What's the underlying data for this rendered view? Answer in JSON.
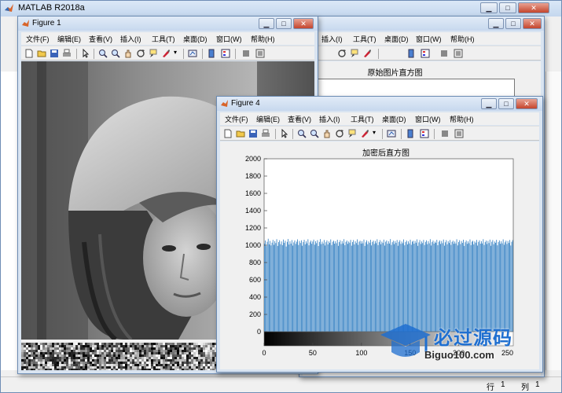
{
  "main_window": {
    "title": "MATLAB R2018a",
    "status_row_label": "行",
    "status_row_value": "1",
    "status_col_label": "列",
    "status_col_value": "1"
  },
  "figure1": {
    "title": "Figure 1",
    "menu": [
      "文件(F)",
      "编辑(E)",
      "查看(V)",
      "插入(I)",
      "工具(T)",
      "桌面(D)",
      "窗口(W)",
      "帮助(H)"
    ]
  },
  "figure_behind": {
    "menu": [
      "插入(I)",
      "工具(T)",
      "桌面(D)",
      "窗口(W)",
      "帮助(H)"
    ],
    "axes_title": "原始图片直方图"
  },
  "figure4": {
    "title": "Figure 4",
    "menu": [
      "文件(F)",
      "编辑(E)",
      "查看(V)",
      "插入(I)",
      "工具(T)",
      "桌面(D)",
      "窗口(W)",
      "帮助(H)"
    ]
  },
  "toolbar_icons": [
    "new-figure-icon",
    "open-file-icon",
    "save-icon",
    "print-icon",
    "edit-plot-icon",
    "zoom-in-icon",
    "zoom-out-icon",
    "pan-icon",
    "rotate-3d-icon",
    "data-cursor-icon",
    "brush-icon",
    "link-plot-icon",
    "colorbar-icon",
    "legend-icon",
    "hide-plot-tools-icon",
    "show-plot-tools-icon"
  ],
  "chart_data": {
    "type": "bar",
    "title": "加密后直方图",
    "xlim": [
      0,
      255
    ],
    "ylim": [
      0,
      2000
    ],
    "xticks": [
      0,
      50,
      100,
      150,
      200,
      250
    ],
    "yticks": [
      0,
      200,
      400,
      600,
      800,
      1000,
      1200,
      1400,
      1600,
      1800,
      2000
    ],
    "bar_color": "#2f7dc1",
    "bins": 256,
    "series": [
      {
        "x_range": [
          0,
          255
        ],
        "values": [
          1020,
          1055,
          990,
          1040,
          1075,
          1010,
          1050,
          998,
          1030,
          1062,
          1005,
          1048,
          1025,
          1070,
          992,
          1036,
          1058,
          1012,
          1044,
          1001,
          1066,
          1028,
          1052,
          985,
          1039,
          1072,
          1008,
          1046,
          1019,
          1060,
          996,
          1033,
          1055,
          1015,
          1041,
          1068,
          1003,
          1049,
          1026,
          1057,
          994,
          1037,
          1063,
          1011,
          1045,
          1022,
          1069,
          999,
          1034,
          1054,
          1017,
          1043,
          1065,
          1006,
          1047,
          1024,
          1059,
          991,
          1038,
          1071,
          1013,
          1042,
          1020,
          1061,
          997,
          1035,
          1056,
          1009,
          1044,
          1027,
          1067,
          1002,
          1040,
          1053,
          1018,
          1046,
          1023,
          1064,
          993,
          1036,
          1058,
          1014,
          1048,
          1021,
          1070,
          1000,
          1039,
          1055,
          1016,
          1043,
          1029,
          1062,
          995,
          1037,
          1060,
          1010,
          1045,
          1025,
          1068,
          1004,
          1041,
          1052,
          1019,
          1047,
          1022,
          1066,
          992,
          1034,
          1057,
          1012,
          1044,
          1028,
          1063,
          998,
          1038,
          1054,
          1015,
          1049,
          1024,
          1069,
          1001,
          1036,
          1059,
          1011,
          1042,
          1026,
          1065,
          996,
          1040,
          1056,
          1017,
          1046,
          1020,
          1071,
          1003,
          1035,
          1053,
          1013,
          1048,
          1027,
          1061,
          994,
          1039,
          1058,
          1016,
          1043,
          1023,
          1067,
          999,
          1037,
          1055,
          1010,
          1045,
          1021,
          1064,
          1005,
          1041,
          1052,
          1018,
          1050,
          1029,
          1068,
          993,
          1033,
          1060,
          1014,
          1044,
          1025,
          1062,
          1002,
          1038,
          1057,
          1012,
          1047,
          1022,
          1070,
          997,
          1036,
          1054,
          1019,
          1042,
          1028,
          1063,
          1000,
          1040,
          1056,
          1015,
          1049,
          1024,
          1066,
          995,
          1034,
          1059,
          1011,
          1046,
          1026,
          1061,
          1004,
          1039,
          1053,
          1017,
          1043,
          1020,
          1069,
          998,
          1037,
          1058,
          1013,
          1048,
          1027,
          1064,
          992,
          1035,
          1055,
          1016,
          1045,
          1023,
          1067,
          1001,
          1041,
          1052,
          1010,
          1044,
          1029,
          1062,
          996,
          1038,
          1057,
          1018,
          1047,
          1021,
          1070,
          1003,
          1036,
          1054,
          1014,
          1050,
          1025,
          1065,
          994,
          1040,
          1060,
          1012,
          1043,
          1028,
          1063,
          999,
          1037,
          1056,
          1017,
          1046,
          1022,
          1068,
          1005,
          1034,
          1053,
          1015,
          1049,
          1026,
          1061,
          997,
          1039,
          1059
        ]
      }
    ]
  },
  "watermark": {
    "brand": "必过源码",
    "url": "Biguo100.com"
  }
}
